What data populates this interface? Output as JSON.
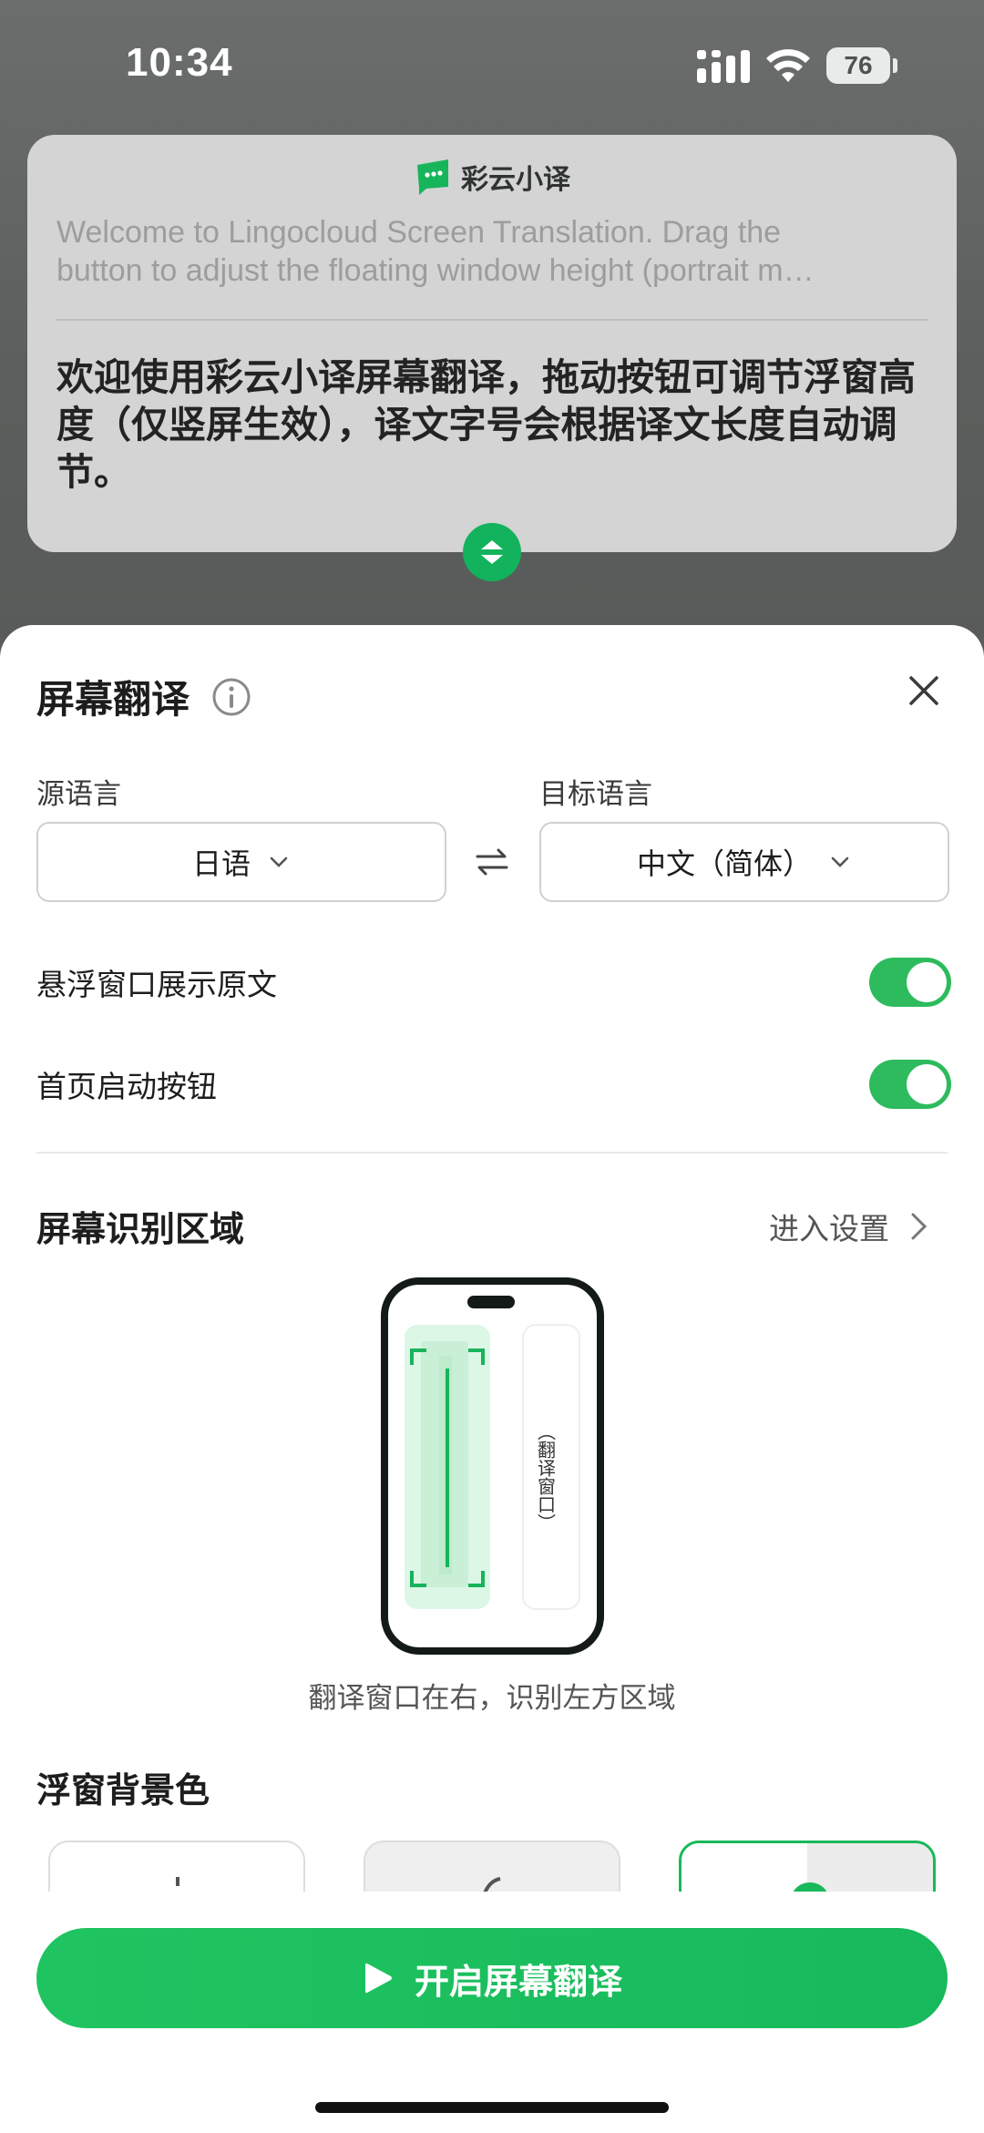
{
  "status_bar": {
    "time": "10:34",
    "battery": "76"
  },
  "floating_window": {
    "brand": "彩云小译",
    "source_lines": [
      "Welcome to Lingocloud Screen Translation. Drag the",
      "button to adjust the floating window height (portrait m…"
    ],
    "translation": "欢迎使用彩云小译屏幕翻译，拖动按钮可调节浮窗高度（仅竖屏生效），译文字号会根据译文长度自动调节。"
  },
  "sheet": {
    "title": "屏幕翻译",
    "source_language_label": "源语言",
    "target_language_label": "目标语言",
    "source_language": "日语",
    "target_language": "中文（简体）",
    "toggle_show_original": {
      "label": "悬浮窗口展示原文",
      "on": true
    },
    "toggle_home_button": {
      "label": "首页启动按钮",
      "on": true
    },
    "recognition_area_title": "屏幕识别区域",
    "settings_link": "进入设置",
    "illustration_window_text": "（翻译窗口）",
    "illustration_caption": "翻译窗口在右，识别左方区域",
    "background_color_title": "浮窗背景色",
    "start_button": "开启屏幕翻译"
  },
  "colors": {
    "accent": "#19b85a",
    "toggle_on": "#2dbb5d",
    "card_bg": "#d3d4d3"
  },
  "icons": [
    "signal-icon",
    "wifi-icon",
    "battery-icon",
    "app-logo-icon",
    "resize-handle-icon",
    "info-icon",
    "close-icon",
    "chevron-down-icon",
    "swap-icon",
    "chevron-right-icon",
    "play-icon"
  ]
}
